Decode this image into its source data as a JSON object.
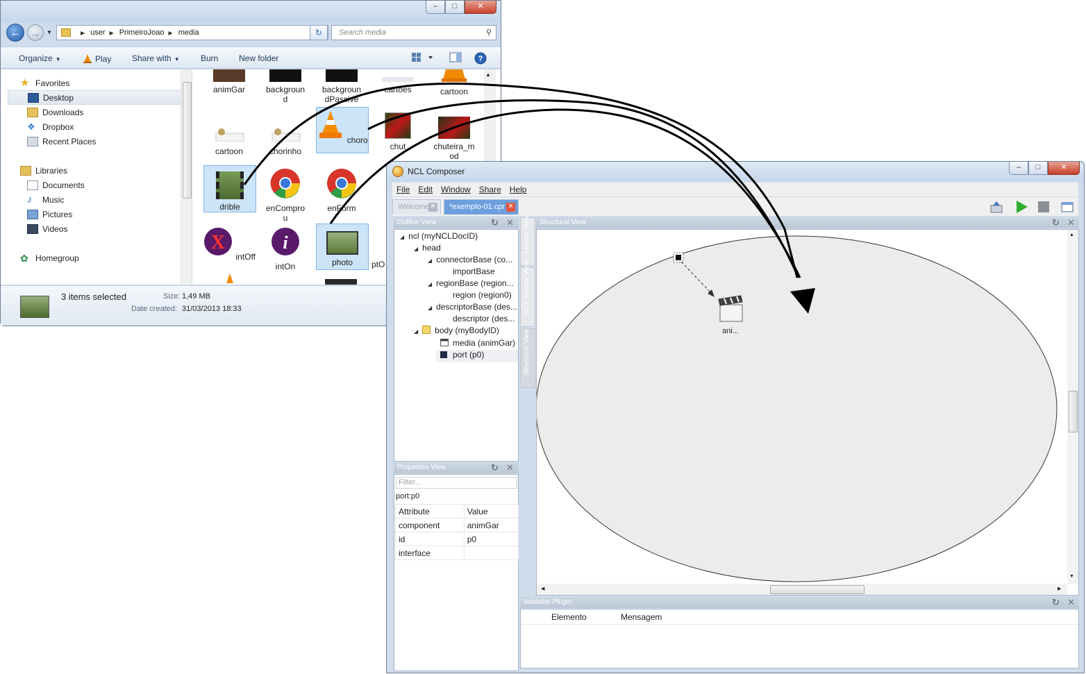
{
  "explorer": {
    "breadcrumb": [
      "user",
      "PrimeiroJoao",
      "media"
    ],
    "search_placeholder": "Search media",
    "toolbar": {
      "organize": "Organize",
      "play": "Play",
      "share_with": "Share with",
      "burn": "Burn",
      "new_folder": "New folder"
    },
    "nav": {
      "favorites": "Favorites",
      "desktop": "Desktop",
      "downloads": "Downloads",
      "dropbox": "Dropbox",
      "recent_places": "Recent Places",
      "libraries": "Libraries",
      "documents": "Documents",
      "music": "Music",
      "pictures": "Pictures",
      "videos": "Videos",
      "homegroup": "Homegroup"
    },
    "files": {
      "f1": "animGar",
      "f2a": "backgroun",
      "f2b": "d",
      "f3a": "backgroun",
      "f3b": "dPassive",
      "f4": "cartoes",
      "f5": "cartoon",
      "f6": "cartoon",
      "f7": "chorinho",
      "f8": "choro",
      "f9": "chut",
      "f10a": "chuteira_m",
      "f10b": "od",
      "f11": "drible",
      "f12a": "enCompro",
      "f12b": "u",
      "f13": "enForm",
      "f14": "intOff",
      "f15": "intOn",
      "f16": "photo",
      "f17": "ptO"
    },
    "details": {
      "selected": "3 items selected",
      "size_label": "Size:",
      "size": "1,49 MB",
      "date_label": "Date created:",
      "date": "31/03/2013 18:33"
    }
  },
  "composer": {
    "title": "NCL Composer",
    "menu": {
      "file": "File",
      "edit": "Edit",
      "window": "Window",
      "share": "Share",
      "help": "Help"
    },
    "tabs": {
      "welcome": "Welcome",
      "doc": "*exemplo-01.cpr"
    },
    "outline": {
      "header": "Outline View",
      "n1": "ncl (myNCLDocID)",
      "n2": "head",
      "n3": "connectorBase (co...",
      "n4": "importBase",
      "n5": "regionBase (region...",
      "n6": "region (region0)",
      "n7": "descriptorBase (des...",
      "n8": "descriptor (des...",
      "n9": "body (myBodyID)",
      "n10": "media (animGar)",
      "n11": "port (p0)"
    },
    "properties": {
      "header": "Properties View",
      "filter": "Filter...",
      "entity": "port:p0",
      "col_attr": "Attribute",
      "col_val": "Value",
      "r1a": "component",
      "r1v": "animGar",
      "r2a": "id",
      "r2v": "p0",
      "r3a": "interface",
      "r3v": ""
    },
    "vtabs": {
      "layout": "Layout View",
      "textual": "NCL Textual View",
      "structural": "Structural View"
    },
    "structural": {
      "header": "Structural View",
      "media_label": "ani..."
    },
    "validator": {
      "header": "Validator Plugin",
      "col_elem": "Elemento",
      "col_msg": "Mensagem"
    }
  }
}
